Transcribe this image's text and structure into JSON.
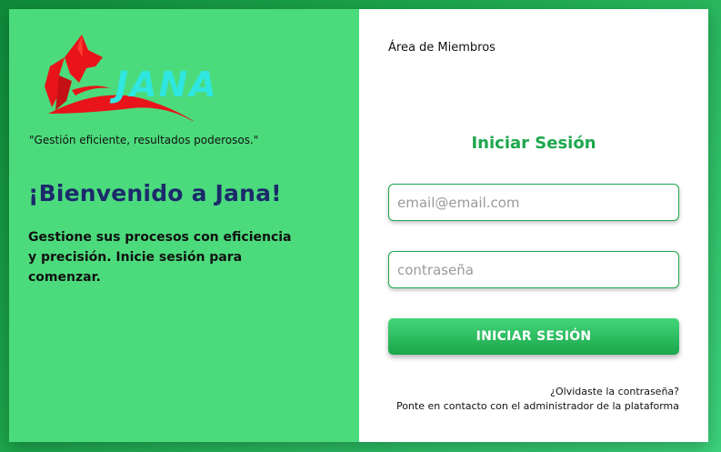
{
  "brand": {
    "name": "JANA",
    "tagline": "\"Gestión eficiente, resultados poderosos.\"",
    "logo_text_color": "#2fe6e0",
    "logo_mark_color": "#e8141a"
  },
  "welcome": {
    "heading": "¡Bienvenido a Jana!",
    "subtitle": "Gestione sus procesos con eficiencia y precisión. Inicie sesión para comenzar."
  },
  "login": {
    "section_label": "Área de Miembros",
    "title": "Iniciar Sesión",
    "email_placeholder": "email@email.com",
    "password_placeholder": "contraseña",
    "submit_label": "INICIAR SESIÓN",
    "forgot_text": "¿Olvidaste la contraseña?",
    "contact_text": "Ponte en contacto con el administrador de la plataforma"
  },
  "colors": {
    "left_panel": "#4cdb7c",
    "accent": "#1ea74d",
    "heading": "#1b2a6b"
  }
}
